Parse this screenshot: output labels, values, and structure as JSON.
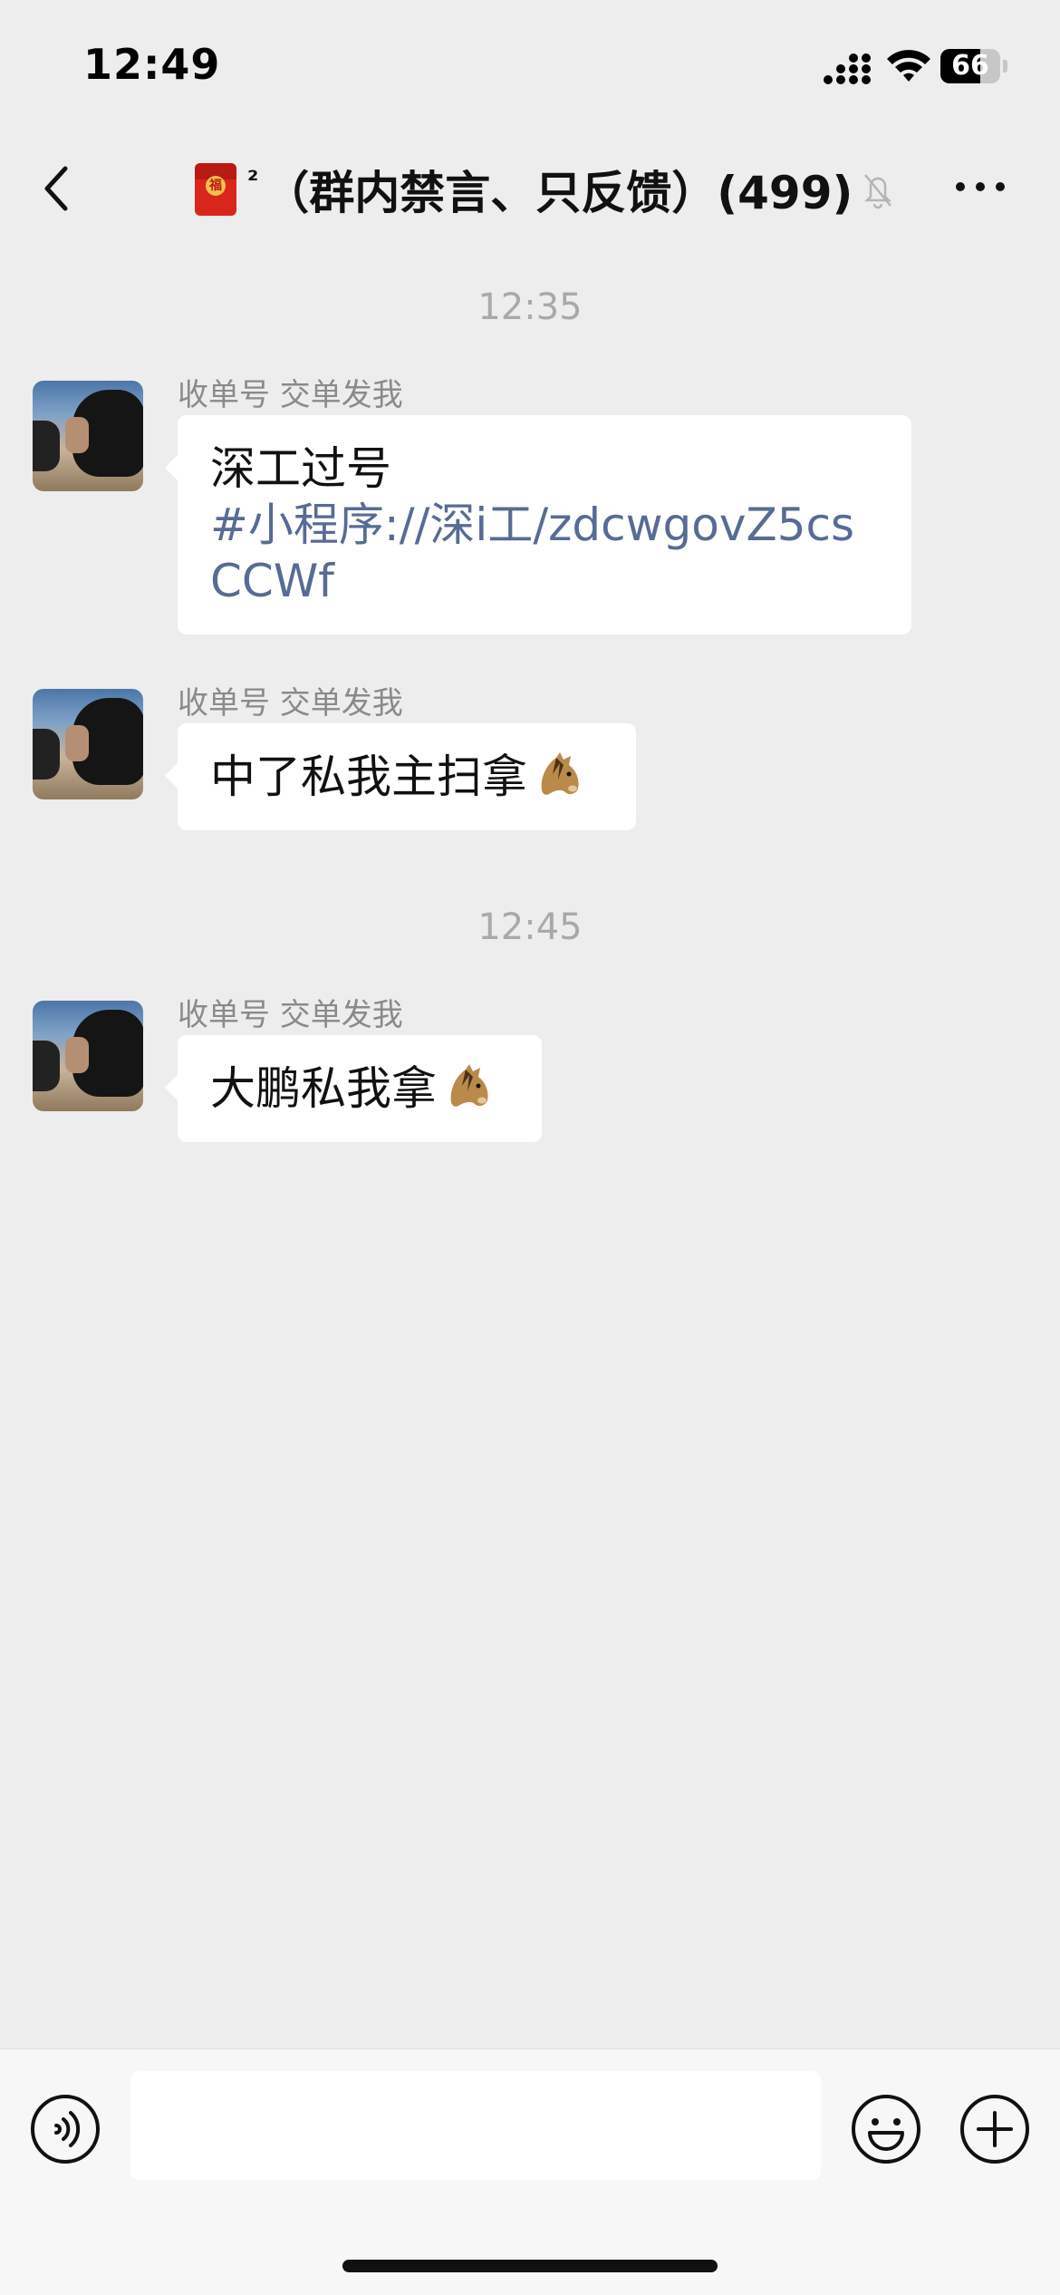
{
  "status_bar": {
    "time": "12:49",
    "battery_level": "66",
    "battery_fraction": 0.66
  },
  "nav": {
    "title": "（群内禁言、只反馈）(499)",
    "title_prefix_superscript": "²",
    "envelope_char": "福",
    "icons": [
      "chevron-left-icon",
      "red-envelope-icon",
      "bell-muted-icon",
      "more-dots-icon"
    ]
  },
  "chat": {
    "timestamps": [
      "12:35",
      "12:45"
    ],
    "messages": [
      {
        "sender": "收单号 交单发我",
        "text": "深工过号",
        "link": "#小程序://深i工/zdcwgovZ5csCCWf",
        "emoji": ""
      },
      {
        "sender": "收单号 交单发我",
        "text": "中了私我主扫拿",
        "link": "",
        "emoji": "horse-face-icon"
      },
      {
        "sender": "收单号 交单发我",
        "text": "大鹏私我拿",
        "link": "",
        "emoji": "horse-face-icon"
      }
    ]
  },
  "input_bar": {
    "value": "",
    "icons": [
      "voice-icon",
      "emoji-icon",
      "plus-icon"
    ]
  },
  "colors": {
    "background": "#ededed",
    "bubble": "#ffffff",
    "link": "#576b95",
    "timestamp": "#a9a9a9",
    "sender": "#8a8a8a"
  }
}
